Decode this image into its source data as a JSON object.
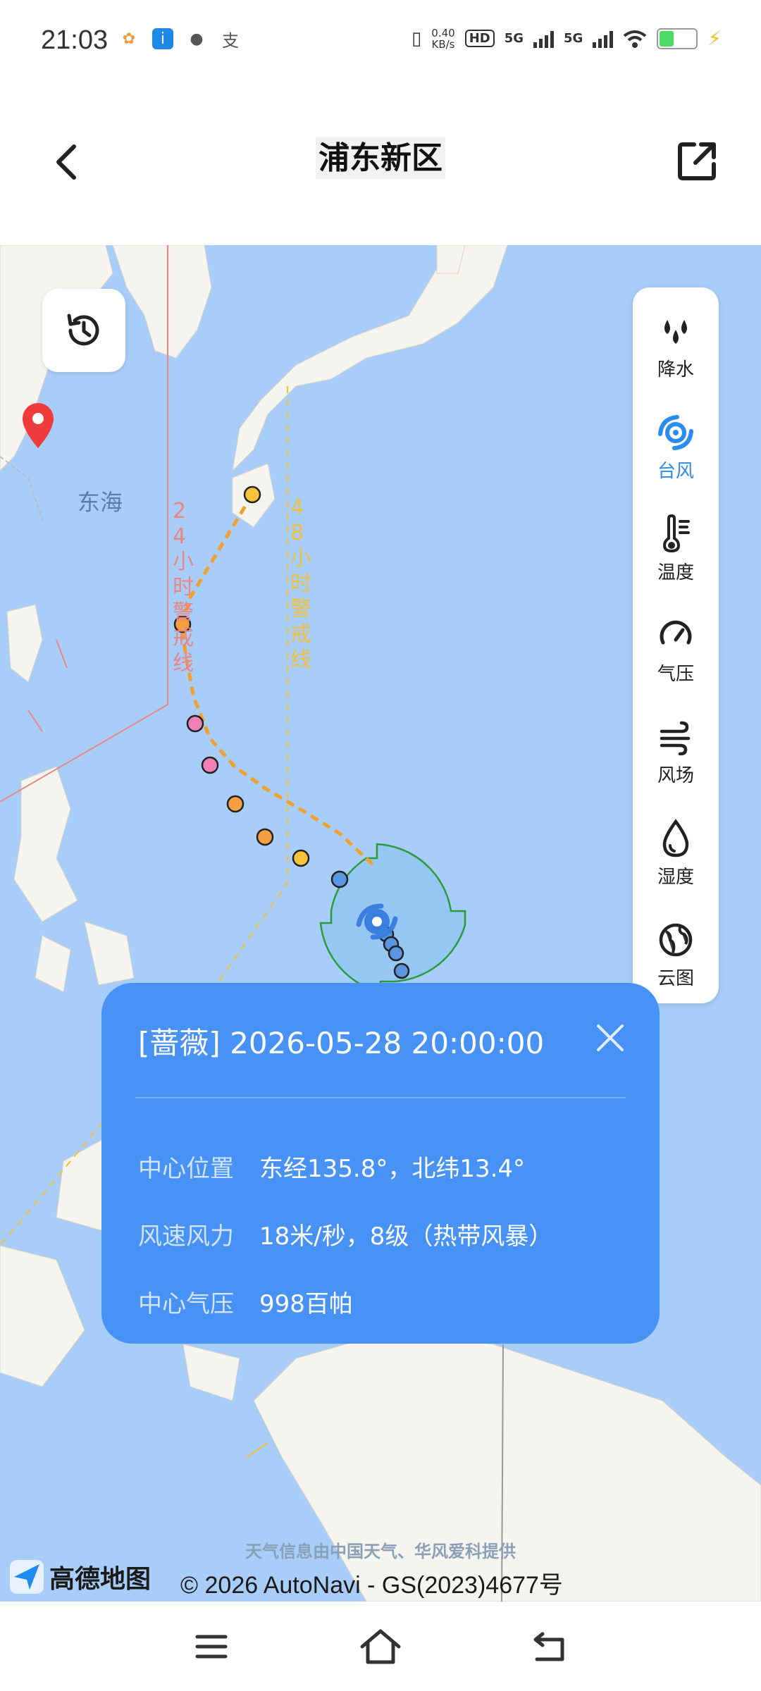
{
  "status_bar": {
    "time": "21:03",
    "speed_value": "0.40",
    "speed_unit": "KB/s",
    "hd_label": "HD",
    "net1": "5G",
    "net2": "5G",
    "left_icons": [
      "pinwheel-app-icon",
      "info-app-icon",
      "wechat-icon",
      "alipay-icon"
    ]
  },
  "header": {
    "title": "浦东新区"
  },
  "map": {
    "labels": {
      "east_sea": "东海",
      "line_24": "24小时警戒线",
      "line_48": "48小时警戒线"
    }
  },
  "layers": [
    {
      "label": "降水",
      "icon": "precipitation-icon",
      "active": false
    },
    {
      "label": "台风",
      "icon": "typhoon-icon",
      "active": true
    },
    {
      "label": "温度",
      "icon": "thermometer-icon",
      "active": false
    },
    {
      "label": "气压",
      "icon": "gauge-icon",
      "active": false
    },
    {
      "label": "风场",
      "icon": "wind-icon",
      "active": false
    },
    {
      "label": "湿度",
      "icon": "droplet-icon",
      "active": false
    },
    {
      "label": "云图",
      "icon": "globe-icon",
      "active": false
    }
  ],
  "info_card": {
    "title": "[蔷薇] 2026-05-28 20:00:00",
    "rows": [
      {
        "key": "中心位置",
        "value": "东经135.8°，北纬13.4°"
      },
      {
        "key": "风速风力",
        "value": "18米/秒，8级（热带风暴）"
      },
      {
        "key": "中心气压",
        "value": "998百帕"
      }
    ]
  },
  "footer": {
    "attribution": "天气信息由中国天气、华风爱科提供",
    "logo_text": "高德地图",
    "copyright": "© 2026 AutoNavi - GS(2023)4677号"
  },
  "colors": {
    "ocean": "#a8cdf8",
    "land": "#f6f4ee",
    "card": "#4892f5",
    "accent": "#2a8cf0",
    "line_24": "#e98585",
    "line_48": "#f0c040",
    "track": "#f0a030"
  }
}
